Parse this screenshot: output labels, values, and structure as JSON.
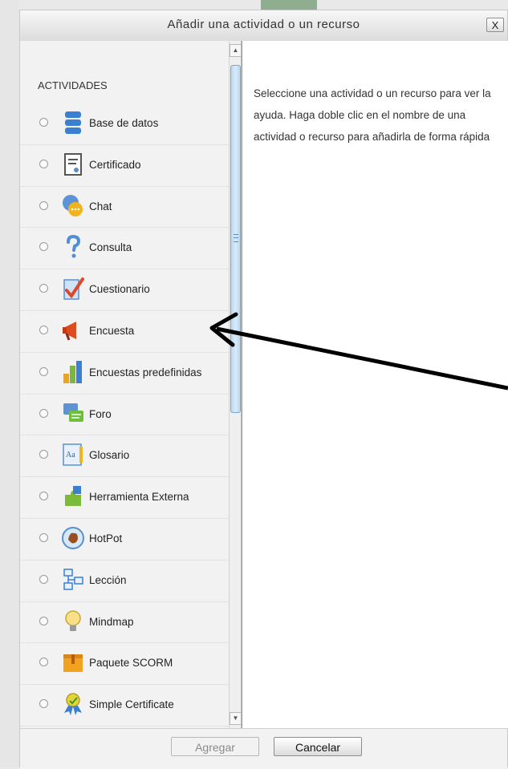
{
  "dialog": {
    "title": "Añadir una actividad o un recurso",
    "close_label": "X"
  },
  "section_label": "ACTIVIDADES",
  "items": [
    {
      "label": "Base de datos",
      "icon": "database-icon"
    },
    {
      "label": "Certificado",
      "icon": "certificate-icon"
    },
    {
      "label": "Chat",
      "icon": "chat-icon"
    },
    {
      "label": "Consulta",
      "icon": "question-icon"
    },
    {
      "label": "Cuestionario",
      "icon": "quiz-icon"
    },
    {
      "label": "Encuesta",
      "icon": "megaphone-icon"
    },
    {
      "label": "Encuestas predefinidas",
      "icon": "bar-chart-icon"
    },
    {
      "label": "Foro",
      "icon": "forum-icon"
    },
    {
      "label": "Glosario",
      "icon": "glossary-icon"
    },
    {
      "label": "Herramienta Externa",
      "icon": "puzzle-icon"
    },
    {
      "label": "HotPot",
      "icon": "hotpot-icon"
    },
    {
      "label": "Lección",
      "icon": "lesson-icon"
    },
    {
      "label": "Mindmap",
      "icon": "lightbulb-icon"
    },
    {
      "label": "Paquete SCORM",
      "icon": "package-icon"
    },
    {
      "label": "Simple Certificate",
      "icon": "award-icon"
    }
  ],
  "help_text": "Seleccione una actividad o un recurso para ver la ayuda. Haga doble clic en el nombre de una actividad o recurso para añadirla de forma rápida",
  "buttons": {
    "add": "Agregar",
    "cancel": "Cancelar"
  },
  "colors": {
    "accent_scroll": "#bcd7ee",
    "panel_bg": "#f2f2f2"
  }
}
